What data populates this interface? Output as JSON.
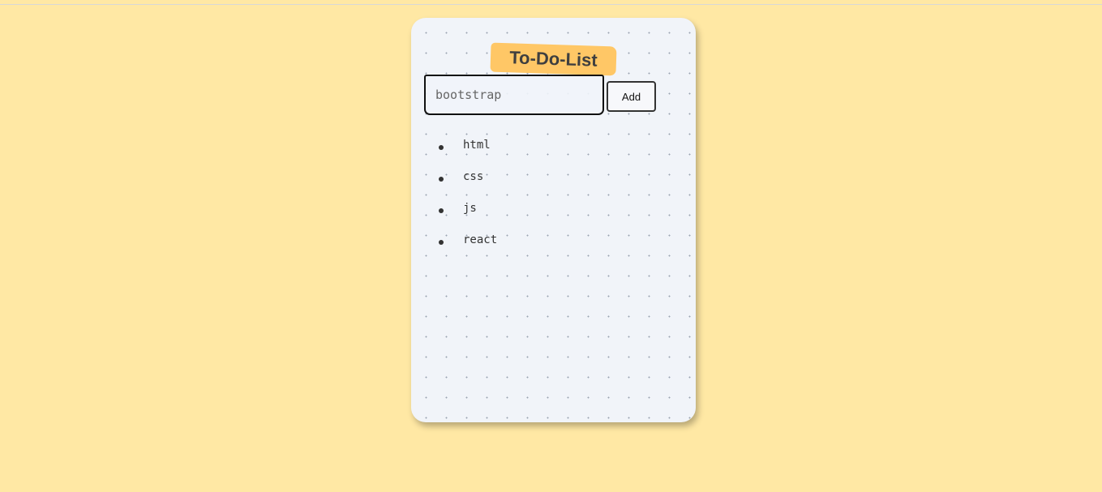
{
  "app": {
    "title": "To-Do-List"
  },
  "input": {
    "placeholder": "bootstrap",
    "value": ""
  },
  "actions": {
    "add_label": "Add"
  },
  "tasks": [
    {
      "text": "html"
    },
    {
      "text": "css"
    },
    {
      "text": "js"
    },
    {
      "text": "react"
    }
  ],
  "colors": {
    "page_background": "#ffe8a4",
    "card_background": "#f1f4f9",
    "title_background": "#ffc766",
    "text": "#333333"
  }
}
